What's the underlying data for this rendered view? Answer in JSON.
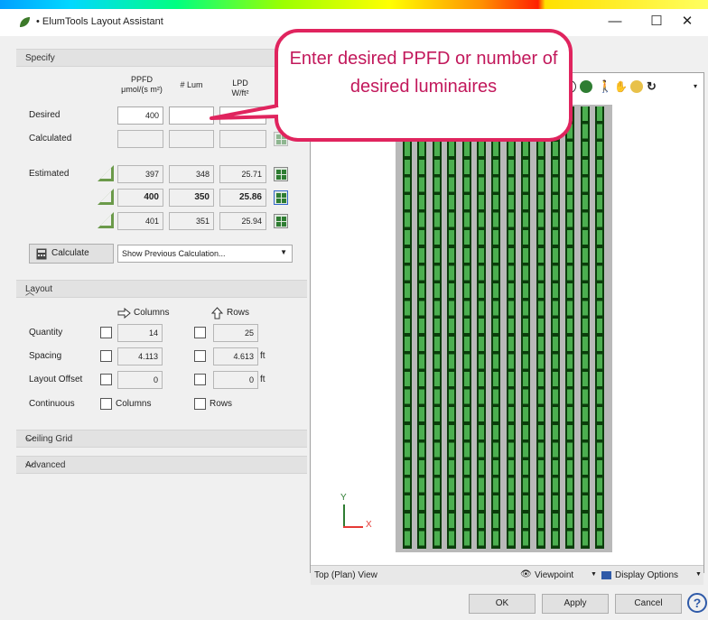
{
  "window": {
    "title": "• ElumTools Layout Assistant"
  },
  "titlebar": {
    "minimize": "—",
    "maximize": "☐",
    "close": "✕"
  },
  "specify": {
    "section_label": "Specify",
    "headers": {
      "ppfd_1": "PPFD",
      "ppfd_2": "μmol/(s m²)",
      "lum": "# Lum",
      "lpd_1": "LPD",
      "lpd_2": "W/ft²"
    },
    "desired_label": "Desired",
    "desired_ppfd": "400",
    "desired_lum": "",
    "desired_lpd": "",
    "calculated_label": "Calculated",
    "estimated_label": "Estimated",
    "estimated_rows": [
      {
        "ppfd": "397",
        "lum": "348",
        "lpd": "25.71"
      },
      {
        "ppfd": "400",
        "lum": "350",
        "lpd": "25.86"
      },
      {
        "ppfd": "401",
        "lum": "351",
        "lpd": "25.94"
      }
    ],
    "calculate_button": "Calculate",
    "previous_select": "Show Previous Calculation..."
  },
  "layout": {
    "section_label": "Layout",
    "columns_label": "Columns",
    "rows_label": "Rows",
    "quantity_label": "Quantity",
    "quantity_columns": "14",
    "quantity_rows": "25",
    "spacing_label": "Spacing",
    "spacing_columns": "4.113",
    "spacing_rows": "4.613",
    "spacing_unit": "ft",
    "offset_label": "Layout Offset",
    "offset_columns": "0",
    "offset_rows": "0",
    "offset_unit": "ft",
    "continuous_label": "Continuous",
    "continuous_columns": "Columns",
    "continuous_rows": "Rows"
  },
  "ceiling_grid": {
    "section_label": "Ceiling Grid"
  },
  "advanced": {
    "section_label": "Advanced"
  },
  "viewport": {
    "axis_y": "Y",
    "axis_x": "X",
    "view_name": "Top (Plan) View",
    "viewpoint_label": "Viewpoint",
    "display_options_label": "Display Options"
  },
  "footer": {
    "ok": "OK",
    "apply": "Apply",
    "cancel": "Cancel",
    "help": "?"
  },
  "callout": {
    "text": "Enter desired PPFD or number of desired luminaires"
  },
  "colors": {
    "accent": "#e0245e",
    "grid_green": "#4caf50",
    "grid_dark": "#0b3d0b"
  }
}
